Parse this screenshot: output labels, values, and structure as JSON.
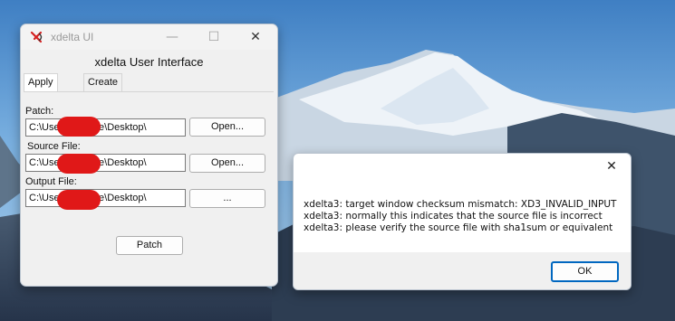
{
  "app": {
    "title": "xdelta UI",
    "heading": "xdelta User Interface",
    "tabs": [
      {
        "label": "Apply Patch",
        "active": true
      },
      {
        "label": "Create Patch",
        "active": false
      }
    ],
    "patch": {
      "label": "Patch:",
      "value": "C:\\Use          OneDrive\\Desktop\\",
      "button": "Open..."
    },
    "source": {
      "label": "Source File:",
      "value": "C:\\Use          OneDrive\\Desktop\\",
      "button": "Open..."
    },
    "output": {
      "label": "Output File:",
      "value": "C:\\Use          OneDrive\\Desktop\\",
      "button": "..."
    },
    "patch_button": "Patch",
    "window_buttons": {
      "minimize": "—",
      "maximize": "☐",
      "close": "✕"
    }
  },
  "dialog": {
    "close": "✕",
    "lines": [
      "xdelta3: target window checksum mismatch: XD3_INVALID_INPUT",
      "xdelta3: normally this indicates that the source file is incorrect",
      "xdelta3: please verify the source file with sha1sum or equivalent"
    ],
    "ok": "OK"
  },
  "colors": {
    "redaction": "#e01818",
    "accent": "#0067c0",
    "logo_red": "#d42020"
  }
}
